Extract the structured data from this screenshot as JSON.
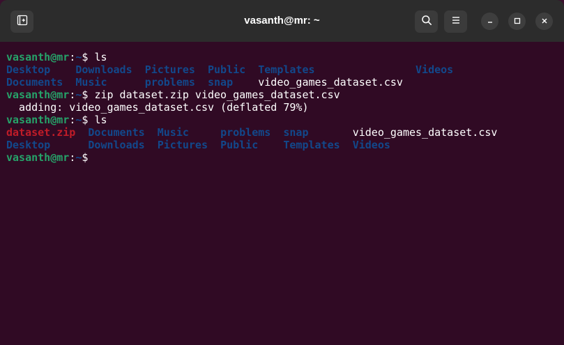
{
  "window": {
    "title": "vasanth@mr: ~"
  },
  "icons": {
    "new_tab": "new-tab-icon",
    "search": "search-icon",
    "menu": "hamburger-menu-icon",
    "minimize": "minimize-icon",
    "maximize": "maximize-icon",
    "close": "close-icon"
  },
  "colors": {
    "background": "#300a24",
    "titlebar": "#2c2c2c",
    "prompt_user": "#26a269",
    "directory": "#12488b",
    "archive": "#c01c28",
    "text": "#ffffff"
  },
  "terminal": {
    "prompt_user": "vasanth@mr",
    "prompt_colon": ":",
    "prompt_path": "~",
    "prompt_dollar": "$ ",
    "cmd1": "ls",
    "ls1_row1": [
      "Desktop",
      "Downloads",
      "Pictures",
      "Public",
      "Templates",
      "Videos"
    ],
    "ls1_row2": [
      "Documents",
      "Music",
      "problems",
      "snap",
      "video_games_dataset.csv"
    ],
    "cmd2": "zip dataset.zip video_games_dataset.csv",
    "zip_output": "  adding: video_games_dataset.csv (deflated 79%)",
    "cmd3": "ls",
    "ls2_row1": [
      "dataset.zip",
      "Documents",
      "Music",
      "problems",
      "snap",
      "video_games_dataset.csv"
    ],
    "ls2_row2": [
      "Desktop",
      "Downloads",
      "Pictures",
      "Public",
      "Templates",
      "Videos"
    ]
  }
}
